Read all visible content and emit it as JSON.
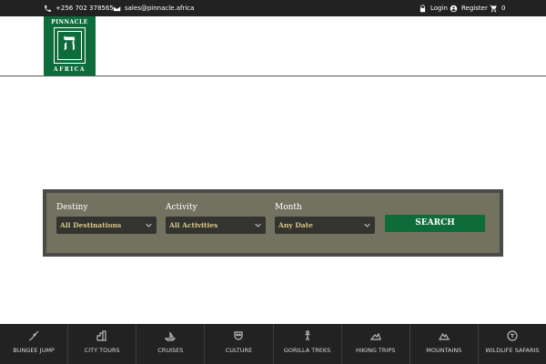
{
  "topbar": {
    "phone": "+256 702 378565",
    "phone_icon": "phone-icon",
    "email": "sales@pinnacle.africa",
    "email_icon": "envelope-icon",
    "login": "Login",
    "login_icon": "lock-icon",
    "register": "Register",
    "register_icon": "user-circle-icon",
    "cart_count": "0",
    "cart_icon": "cart-icon"
  },
  "logo": {
    "top_text": "PINNACLE",
    "glyph": "ה",
    "bottom_text": "AFRICA",
    "color": "#0e6b3a"
  },
  "search": {
    "destiny_label": "Destiny",
    "destiny_value": "All Destinations",
    "activity_label": "Activity",
    "activity_value": "All Activities",
    "month_label": "Month",
    "month_value": "Any Date",
    "button": "SEARCH"
  },
  "categories": [
    {
      "label": "BUNGEE JUMP",
      "icon": "bungee-icon"
    },
    {
      "label": "CITY TOURS",
      "icon": "city-icon"
    },
    {
      "label": "CRUISES",
      "icon": "boat-icon"
    },
    {
      "label": "CULTURE",
      "icon": "mask-icon"
    },
    {
      "label": "GORILLA TREKS",
      "icon": "gorilla-icon"
    },
    {
      "label": "HIKING TRIPS",
      "icon": "hiking-icon"
    },
    {
      "label": "MOUNTAINS",
      "icon": "mountain-icon"
    },
    {
      "label": "WILDLIFE SAFARIS",
      "icon": "wildlife-icon"
    }
  ]
}
